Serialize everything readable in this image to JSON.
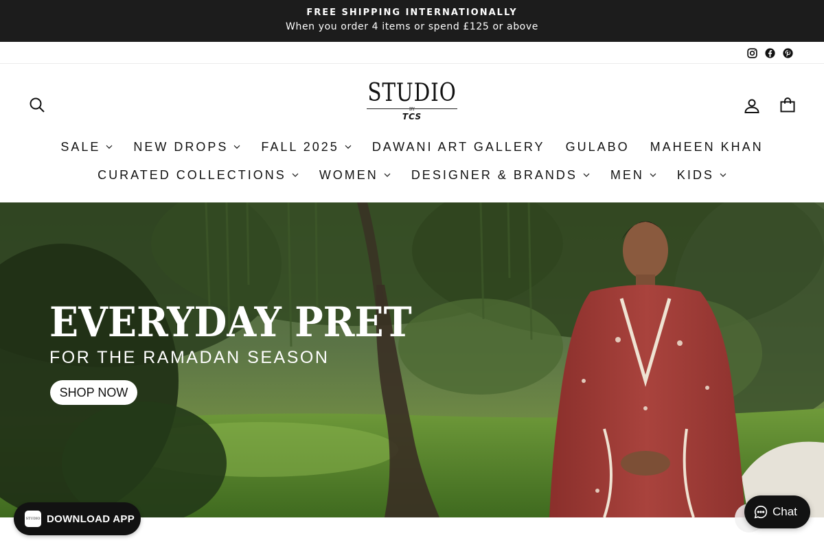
{
  "announcement": {
    "title": "FREE SHIPPING INTERNATIONALLY",
    "subtitle": "When you order 4 items or spend £125 or above"
  },
  "social": {
    "icons": [
      "instagram-icon",
      "facebook-icon",
      "pinterest-icon"
    ]
  },
  "header": {
    "logo_main": "STUDIO",
    "logo_by": "BY",
    "logo_brand": "TCS",
    "icons": [
      "search-icon",
      "user-icon",
      "cart-icon"
    ]
  },
  "nav": {
    "row1": [
      {
        "label": "SALE",
        "has_dropdown": true
      },
      {
        "label": "NEW DROPS",
        "has_dropdown": true
      },
      {
        "label": "FALL 2025",
        "has_dropdown": true
      },
      {
        "label": "DAWANI ART GALLERY",
        "has_dropdown": false
      },
      {
        "label": "GULABO",
        "has_dropdown": false
      },
      {
        "label": "MAHEEN KHAN",
        "has_dropdown": false
      }
    ],
    "row2": [
      {
        "label": "CURATED COLLECTIONS",
        "has_dropdown": true
      },
      {
        "label": "WOMEN",
        "has_dropdown": true
      },
      {
        "label": "DESIGNER & BRANDS",
        "has_dropdown": true
      },
      {
        "label": "MEN",
        "has_dropdown": true
      },
      {
        "label": "KIDS",
        "has_dropdown": true
      }
    ]
  },
  "hero": {
    "title": "EVERYDAY PRET",
    "subtitle": "FOR THE RAMADAN SEASON",
    "cta": "SHOP NOW"
  },
  "widgets": {
    "app_badge_label": "DOWNLOAD APP",
    "app_badge_icon_text": "STUDIO",
    "chat_label": "Chat"
  },
  "colors": {
    "announcement_bg": "#1c1c1c",
    "widget_bg": "#121212",
    "dress_red": "#9e3a36",
    "foliage": "#3d5a2a"
  }
}
